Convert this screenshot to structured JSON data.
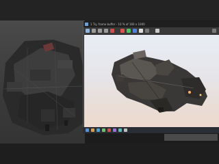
{
  "frame_buffer": {
    "title": "1 Tq, frame buffer - 10 % of 160 x 1000",
    "render_bg": "#ece4e0"
  },
  "toolbar": {
    "icons": [
      "save-icon",
      "copy-icon",
      "clone-icon",
      "print-icon",
      "clear-icon",
      "channel-red-icon",
      "channel-green-icon",
      "channel-blue-icon",
      "alpha-icon",
      "mono-icon",
      "swatch-icon",
      "settings-icon"
    ]
  },
  "colors": {
    "accent": "#5b8fd6",
    "viewport_bg": "#3f3f3f",
    "dark_ui": "#1c1c1c"
  }
}
